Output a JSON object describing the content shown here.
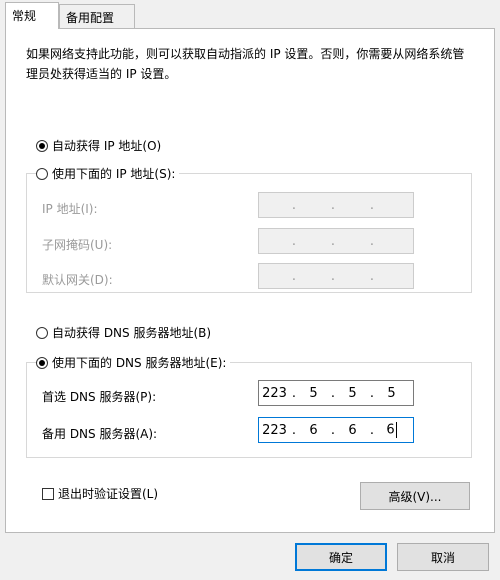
{
  "tabs": [
    {
      "label": "常规",
      "active": true
    },
    {
      "label": "备用配置",
      "active": false
    }
  ],
  "description": "如果网络支持此功能，则可以获取自动指派的 IP 设置。否则，你需要从网络系统管理员处获得适当的 IP 设置。",
  "ip_section": {
    "auto_label": "自动获得 IP 地址(O)",
    "auto_selected": true,
    "manual_label": "使用下面的 IP 地址(S):",
    "manual_selected": false,
    "fields": [
      {
        "label": "IP 地址(I):",
        "value": [
          ".",
          ".",
          "."
        ]
      },
      {
        "label": "子网掩码(U):",
        "value": [
          ".",
          ".",
          "."
        ]
      },
      {
        "label": "默认网关(D):",
        "value": [
          ".",
          ".",
          "."
        ]
      }
    ]
  },
  "dns_section": {
    "auto_label": "自动获得 DNS 服务器地址(B)",
    "auto_selected": false,
    "manual_label": "使用下面的 DNS 服务器地址(E):",
    "manual_selected": true,
    "preferred": {
      "label": "首选 DNS 服务器(P):",
      "octets": [
        "223",
        "5",
        "5",
        "5"
      ]
    },
    "alternate": {
      "label": "备用 DNS 服务器(A):",
      "octets": [
        "223",
        "6",
        "6",
        "6"
      ]
    }
  },
  "validate_label": "退出时验证设置(L)",
  "validate_checked": false,
  "buttons": {
    "advanced": "高级(V)...",
    "ok": "确定",
    "cancel": "取消"
  },
  "colors": {
    "focus_border": "#0078d7",
    "panel_bg": "#ffffff",
    "window_bg": "#f0f0f0"
  }
}
